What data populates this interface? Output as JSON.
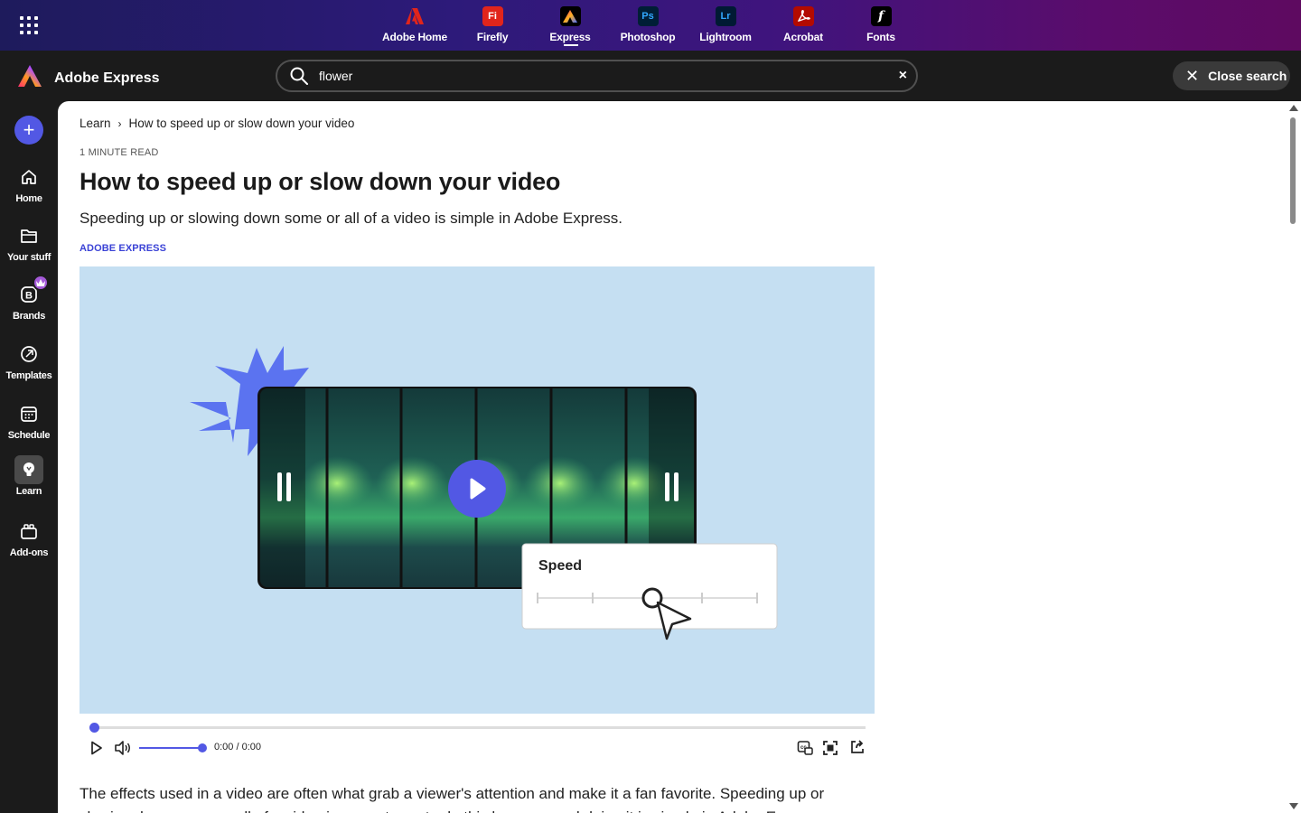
{
  "appbar": {
    "apps": [
      {
        "label": "Adobe Home",
        "icon": "adobe-logo-icon",
        "color": "#e1251b"
      },
      {
        "label": "Firefly",
        "icon": "firefly-icon",
        "abbr": "Fi",
        "color": "#e1251b"
      },
      {
        "label": "Express",
        "icon": "express-icon",
        "color": "#000000",
        "active": true
      },
      {
        "label": "Photoshop",
        "icon": "photoshop-icon",
        "abbr": "Ps",
        "color": "#001e36"
      },
      {
        "label": "Lightroom",
        "icon": "lightroom-icon",
        "abbr": "Lr",
        "color": "#001a34"
      },
      {
        "label": "Acrobat",
        "icon": "acrobat-icon",
        "color": "#b30b00"
      },
      {
        "label": "Fonts",
        "icon": "fonts-icon",
        "abbr": "f",
        "color": "#000000"
      }
    ]
  },
  "header": {
    "brand": "Adobe Express",
    "search_value": "flower",
    "clear_label": "×",
    "close_search": "Close search",
    "close_search_x": "✕"
  },
  "rail": {
    "create_label": "+",
    "items": [
      {
        "label": "Home",
        "icon": "home-icon"
      },
      {
        "label": "Your stuff",
        "icon": "folder-icon"
      },
      {
        "label": "Brands",
        "icon": "brand-icon"
      },
      {
        "label": "Templates",
        "icon": "templates-icon"
      },
      {
        "label": "Schedule",
        "icon": "calendar-icon"
      },
      {
        "label": "Learn",
        "icon": "lightbulb-icon",
        "active": true
      },
      {
        "label": "Add-ons",
        "icon": "addons-icon"
      }
    ]
  },
  "article": {
    "breadcrumb": [
      "Learn",
      "How to speed up or slow down your video"
    ],
    "breadcrumb_sep": "›",
    "read_time": "1 MINUTE READ",
    "title": "How to speed up or slow down your video",
    "subtitle": "Speeding up or slowing down some or all of a video is simple in Adobe Express.",
    "tag": "ADOBE EXPRESS",
    "video": {
      "speed_label": "Speed",
      "time": "0:00 / 0:00",
      "progress": 0,
      "volume": 1.0
    },
    "body": "The effects used in a video are often what grab a viewer's attention and make it a fan favorite. Speeding up or slowing down some or all of a video is a great way to do this because and doing it is simple in Adobe Express."
  },
  "colors": {
    "accent": "#5258e4",
    "tag": "#3b43d6",
    "video_bg": "#c5dff2",
    "starburst": "#5b73f0"
  }
}
